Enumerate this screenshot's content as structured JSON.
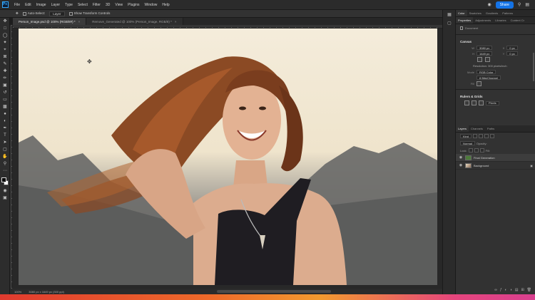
{
  "app": {
    "logo": "Ps",
    "menu": [
      "File",
      "Edit",
      "Image",
      "Layer",
      "Type",
      "Select",
      "Filter",
      "3D",
      "View",
      "Plugins",
      "Window",
      "Help"
    ],
    "share_label": "Share"
  },
  "options": {
    "auto_select_label": "Auto-Select:",
    "auto_select_value": "Layer",
    "transform_label": "Show Transform Controls"
  },
  "tabs": [
    {
      "label": "Person_Image.psd @ 100% (RGB/8#) *",
      "active": true
    },
    {
      "label": "Remove_Generated @ 100% (Person_Image, RGB/8) *",
      "active": false
    }
  ],
  "status": {
    "zoom": "100%",
    "dimensions": "3080 px x 1649 px (300 ppi)"
  },
  "panels": {
    "top_tabs": [
      "Color",
      "Swatches",
      "Gradients",
      "Patterns"
    ],
    "prop_tabs": [
      "Properties",
      "Adjustments",
      "Libraries",
      "Content Cr"
    ],
    "document_label": "Document",
    "canvas_title": "Canvas",
    "width_label": "W",
    "width_value": "3080 px",
    "height_label": "H",
    "height_value": "1649 px",
    "x_label": "X",
    "x_value": "0 px",
    "y_label": "Y",
    "y_value": "0 px",
    "resolution": "Resolution: 300 pixels/inch",
    "mode_label": "Mode",
    "mode_value": "RGB Color",
    "depth_value": "8 Bits/Channel",
    "fill_label": "Fill",
    "rulers_title": "Rulers & Grids",
    "rulers_unit": "Pixels"
  },
  "layers_panel": {
    "tabs": [
      "Layers",
      "Channels",
      "Paths"
    ],
    "kind_label": "Kind",
    "blend_value": "Normal",
    "opacity_label": "Opacity:",
    "lock_label": "Lock:",
    "fill_label": "Fill:",
    "layers": [
      {
        "name": "Final Generation",
        "type": "generated"
      },
      {
        "name": "Background",
        "type": "background"
      }
    ]
  }
}
